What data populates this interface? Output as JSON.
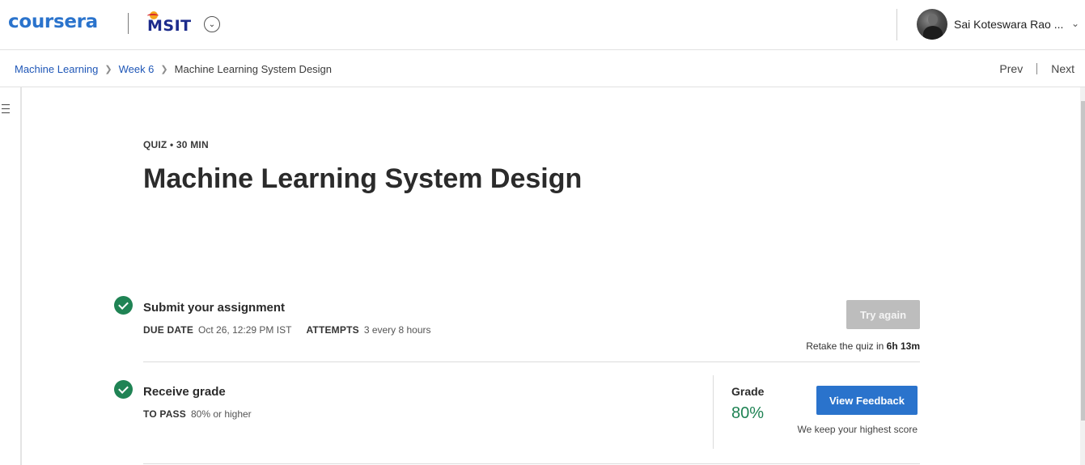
{
  "header": {
    "brand": "coursera",
    "institution_logo_text": "MSIT",
    "user_name": "Sai Koteswara Rao ...",
    "colors": {
      "brand": "#2a73cc",
      "institution": "#1c2b8c"
    }
  },
  "breadcrumb": {
    "items": [
      "Machine Learning",
      "Week 6"
    ],
    "current": "Machine Learning System Design"
  },
  "pager": {
    "prev": "Prev",
    "next": "Next"
  },
  "quiz": {
    "eyebrow": "QUIZ • 30 MIN",
    "title": "Machine Learning System Design"
  },
  "submit_step": {
    "title": "Submit your assignment",
    "due_label": "DUE DATE",
    "due_value": "Oct 26, 12:29 PM IST",
    "attempts_label": "ATTEMPTS",
    "attempts_value": "3 every 8 hours",
    "try_again_label": "Try again",
    "retake_prefix": "Retake the quiz in",
    "retake_time": "6h 13m"
  },
  "grade_step": {
    "title": "Receive grade",
    "to_pass_label": "TO PASS",
    "to_pass_value": "80% or higher",
    "grade_label": "Grade",
    "grade_value": "80%",
    "view_feedback_label": "View Feedback",
    "keep_score_text": "We keep your highest score",
    "colors": {
      "pass": "#1f8354",
      "primary_button": "#2a73cc",
      "disabled_button": "#bdbdbd"
    }
  }
}
